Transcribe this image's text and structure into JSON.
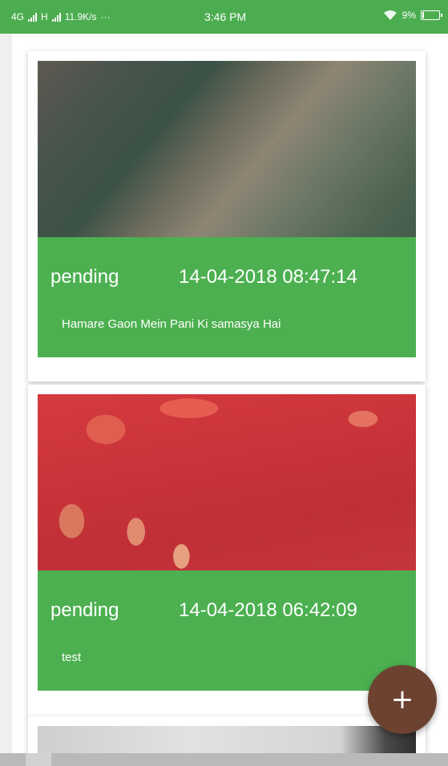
{
  "status_bar": {
    "network_left": "4G",
    "network_mid": "H",
    "speed": "11.9K/s",
    "more": "···",
    "time": "3:46 PM",
    "battery_text": "9%",
    "battery_level": 0.09,
    "color": "#4cad50"
  },
  "posts": [
    {
      "status": "pending",
      "datetime": "14-04-2018 08:47:14",
      "description": "Hamare Gaon Mein Pani Ki samasya Hai"
    },
    {
      "status": "pending",
      "datetime": "14-04-2018 06:42:09",
      "description": "test"
    }
  ],
  "fab": {
    "label": "+",
    "color": "#6d4231"
  },
  "colors": {
    "card_info": "#4cb050",
    "status_bar": "#4cad50",
    "fab": "#6d4231"
  },
  "icons": {
    "signal": "signal-icon",
    "wifi": "wifi-icon",
    "battery": "battery-icon",
    "add": "add-icon"
  }
}
